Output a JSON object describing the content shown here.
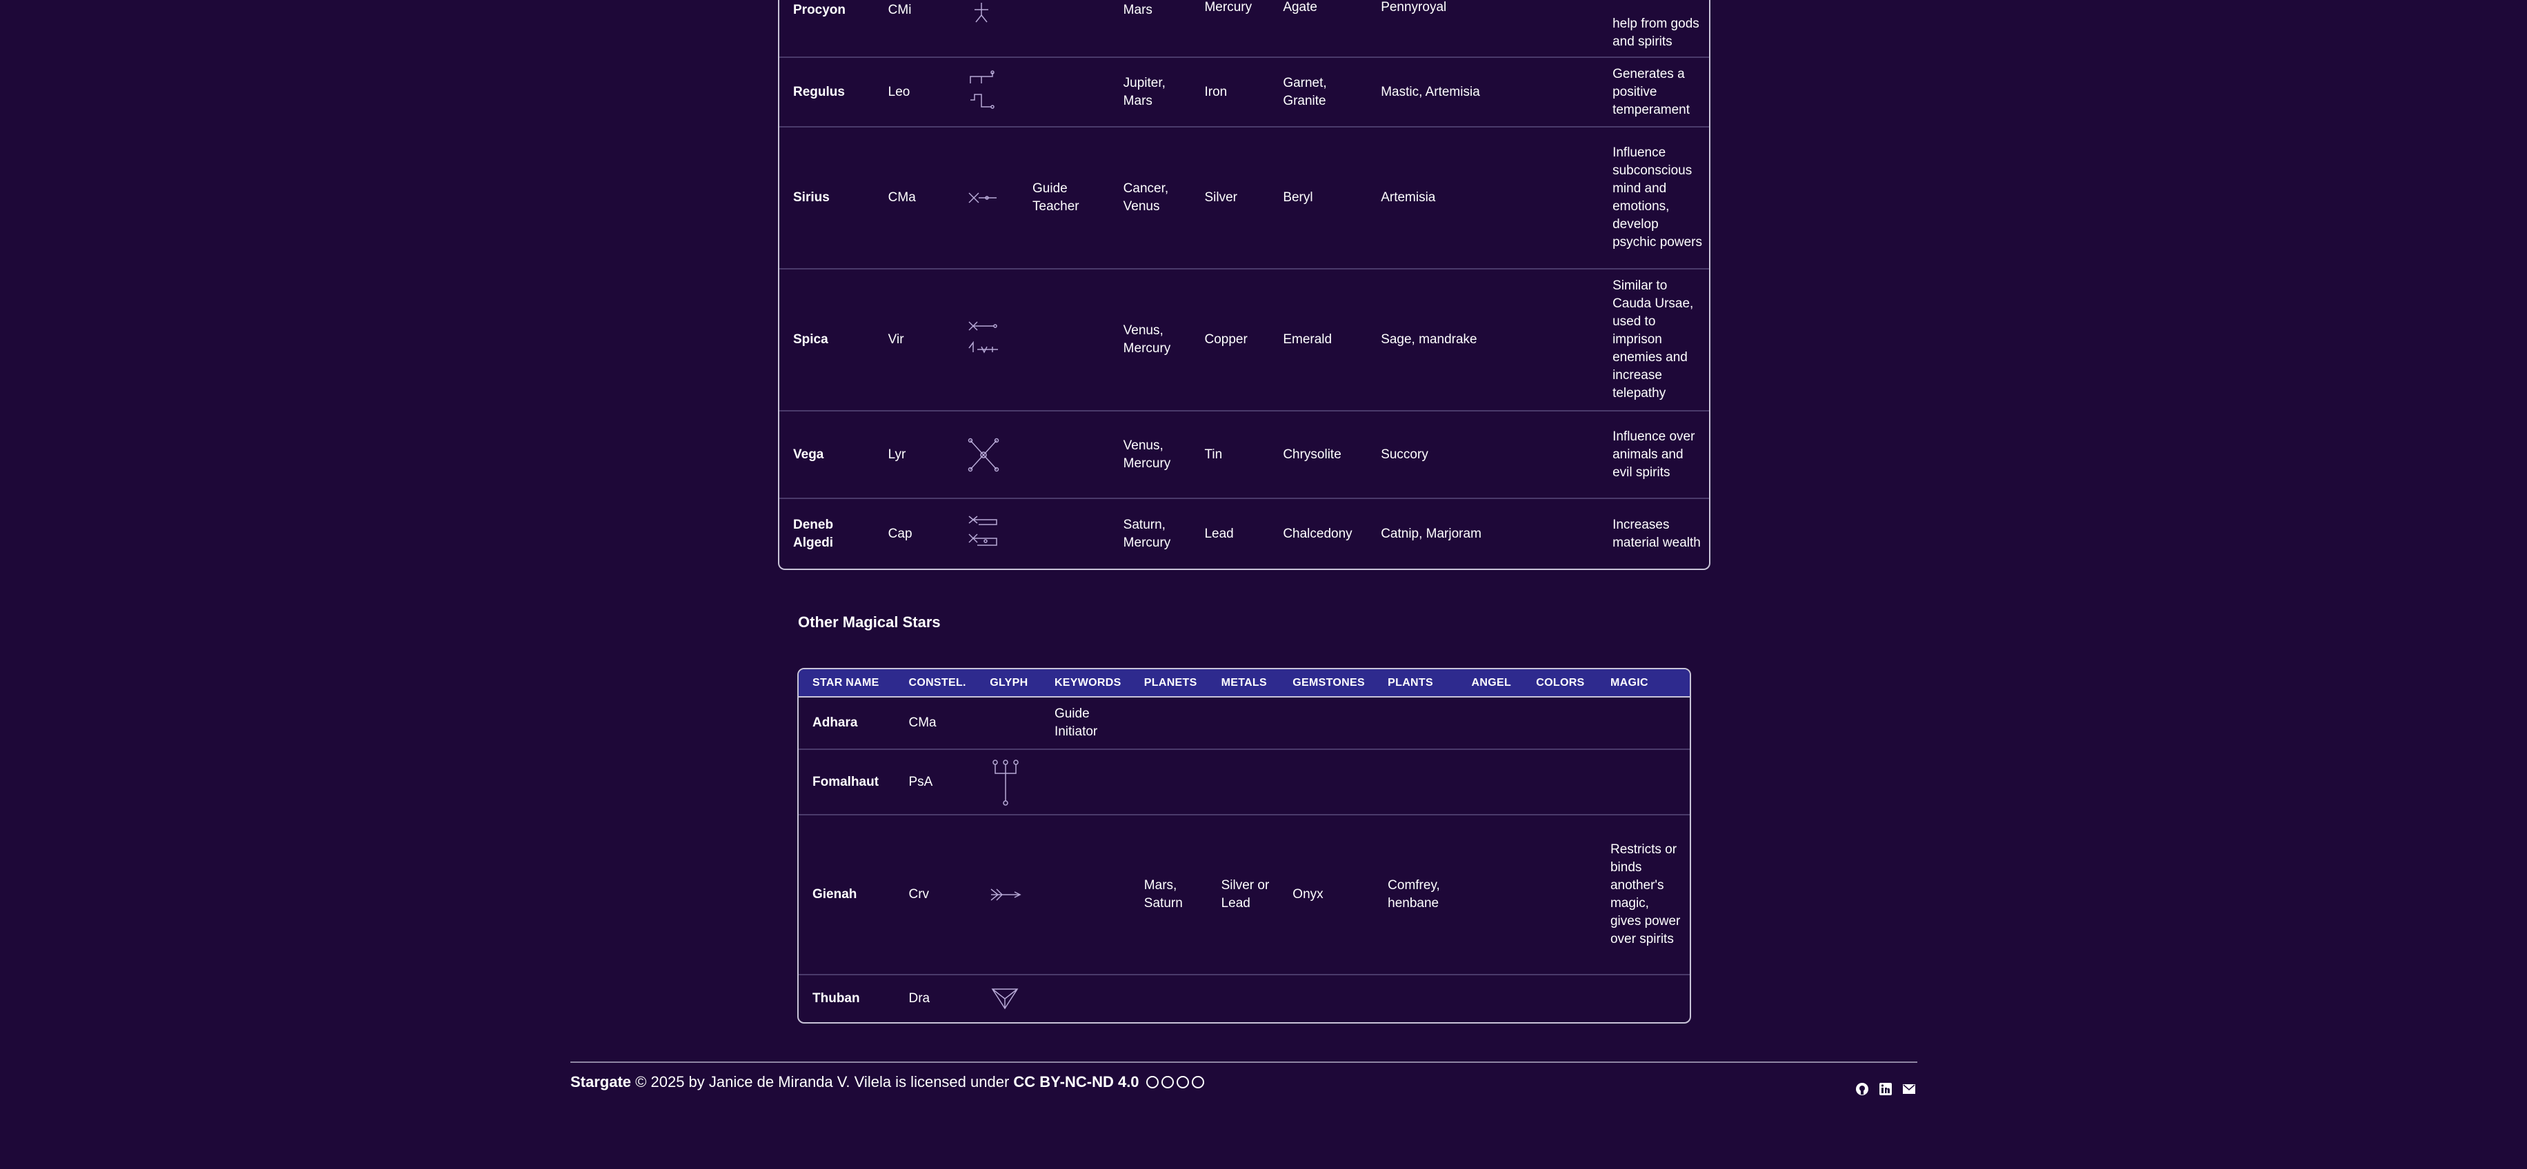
{
  "table1": {
    "rows": [
      {
        "name": "Procyon",
        "constel": "CMi",
        "keywords": "",
        "planets": "Mars",
        "metals": "Mercury",
        "gems": "Agate",
        "plants": "Pennyroyal",
        "magic": "help from gods and spirits"
      },
      {
        "name": "Regulus",
        "constel": "Leo",
        "keywords": "",
        "planets": "Jupiter, Mars",
        "metals": "Iron",
        "gems": "Garnet, Granite",
        "plants": "Mastic, Artemisia",
        "magic": "Generates a positive temperament"
      },
      {
        "name": "Sirius",
        "constel": "CMa",
        "keywords": "Guide Teacher",
        "planets": "Cancer, Venus",
        "metals": "Silver",
        "gems": "Beryl",
        "plants": "Artemisia",
        "magic": "Influence subconscious mind and emotions, develop psychic powers"
      },
      {
        "name": "Spica",
        "constel": "Vir",
        "keywords": "",
        "planets": "Venus, Mercury",
        "metals": "Copper",
        "gems": "Emerald",
        "plants": "Sage, mandrake",
        "magic": "Similar to Cauda Ursae, used to imprison enemies and increase telepathy"
      },
      {
        "name": "Vega",
        "constel": "Lyr",
        "keywords": "",
        "planets": "Venus, Mercury",
        "metals": "Tin",
        "gems": "Chrysolite",
        "plants": "Succory",
        "magic": "Influence over animals and evil spirits"
      },
      {
        "name": "Deneb Algedi",
        "constel": "Cap",
        "keywords": "",
        "planets": "Saturn, Mercury",
        "metals": "Lead",
        "gems": "Chalcedony",
        "plants": "Catnip, Marjoram",
        "magic": "Increases material wealth"
      }
    ]
  },
  "section2": {
    "title": "Other Magical Stars",
    "headers": [
      "STAR NAME",
      "CONSTEL.",
      "GLYPH",
      "KEYWORDS",
      "PLANETS",
      "METALS",
      "GEMSTONES",
      "PLANTS",
      "ANGEL",
      "COLORS",
      "MAGIC"
    ],
    "rows": [
      {
        "name": "Adhara",
        "constel": "CMa",
        "keywords": "Guide Initiator",
        "planets": "",
        "metals": "",
        "gems": "",
        "plants": "",
        "angel": "",
        "colors": "",
        "magic": ""
      },
      {
        "name": "Fomalhaut",
        "constel": "PsA",
        "keywords": "",
        "planets": "",
        "metals": "",
        "gems": "",
        "plants": "",
        "angel": "",
        "colors": "",
        "magic": ""
      },
      {
        "name": "Gienah",
        "constel": "Crv",
        "keywords": "",
        "planets": "Mars, Saturn",
        "metals": "Silver or Lead",
        "gems": "Onyx",
        "plants": "Comfrey, henbane",
        "angel": "",
        "colors": "",
        "magic": "Restricts or binds another's magic, gives power over spirits"
      },
      {
        "name": "Thuban",
        "constel": "Dra",
        "keywords": "",
        "planets": "",
        "metals": "",
        "gems": "",
        "plants": "",
        "angel": "",
        "colors": "",
        "magic": ""
      }
    ]
  },
  "footer": {
    "site": "Stargate",
    "copyright": "© 2025 by Janice de Miranda V. Vilela is licensed under",
    "license": "CC BY-NC-ND 4.0",
    "cc_icons": [
      "cc-icon",
      "by-icon",
      "nc-icon",
      "nd-icon"
    ],
    "social_icons": [
      "github-icon",
      "linkedin-icon",
      "email-icon"
    ]
  },
  "colors": {
    "background": "#1e0838",
    "header_bg": "#2e2a8e",
    "border": "#c9c4d8"
  }
}
